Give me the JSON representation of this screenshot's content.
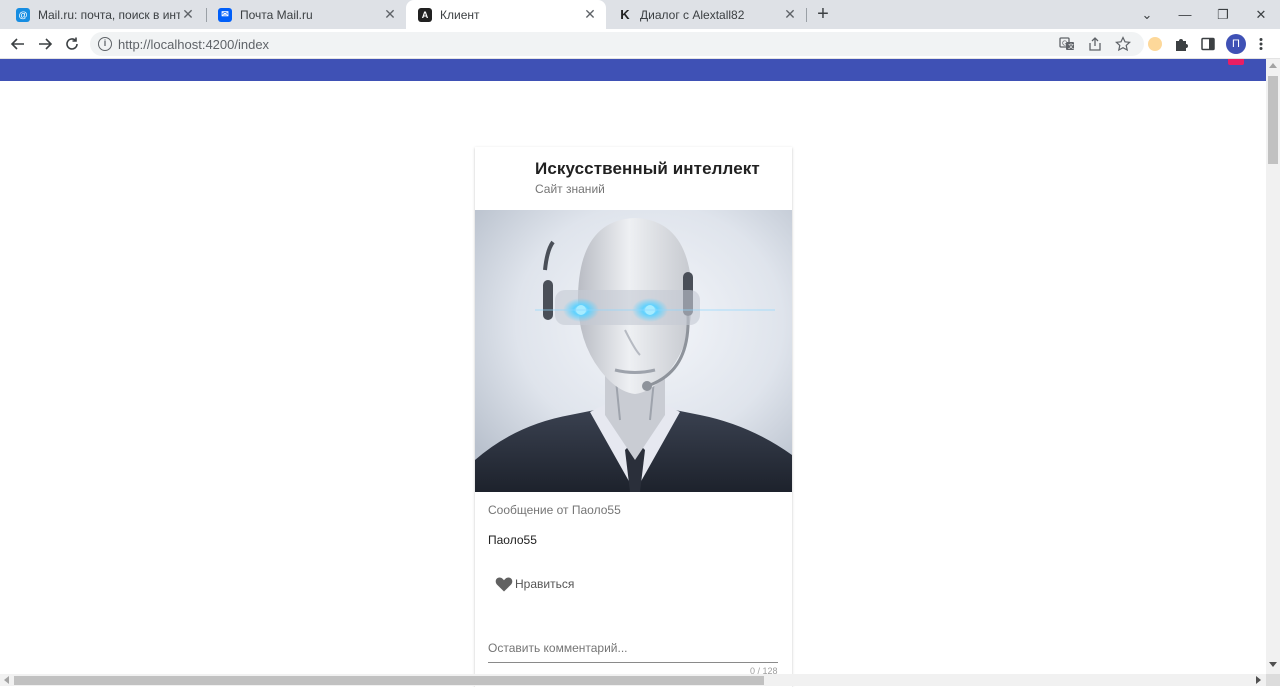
{
  "browser": {
    "tabs": [
      {
        "title": "Mail.ru: почта, поиск в интернете",
        "close": "✕",
        "favicon_color": "#168de2"
      },
      {
        "title": "Почта Mail.ru",
        "close": "✕",
        "favicon_color": "#005ff9"
      },
      {
        "title": "Клиент",
        "close": "✕",
        "favicon_color": "#212121",
        "active": true
      },
      {
        "title": "Диалог с Alextall82",
        "close": "✕",
        "favicon_color": "#f5a623"
      }
    ],
    "new_tab": "+",
    "window_controls": {
      "tabs_menu": "⌄",
      "minimize": "—",
      "restore": "❐",
      "close": "✕"
    },
    "address": "http://localhost:4200/index",
    "profile_initial": "П"
  },
  "app": {
    "header_color": "#3f51b5"
  },
  "card": {
    "title": "Искусственный интеллект",
    "subtitle": "Сайт знаний",
    "message_label": "Сообщение от Паоло55",
    "author": "Паоло55",
    "like_label": "Нравиться",
    "comment_placeholder": "Оставить комментарий...",
    "counter": "0 / 128"
  }
}
